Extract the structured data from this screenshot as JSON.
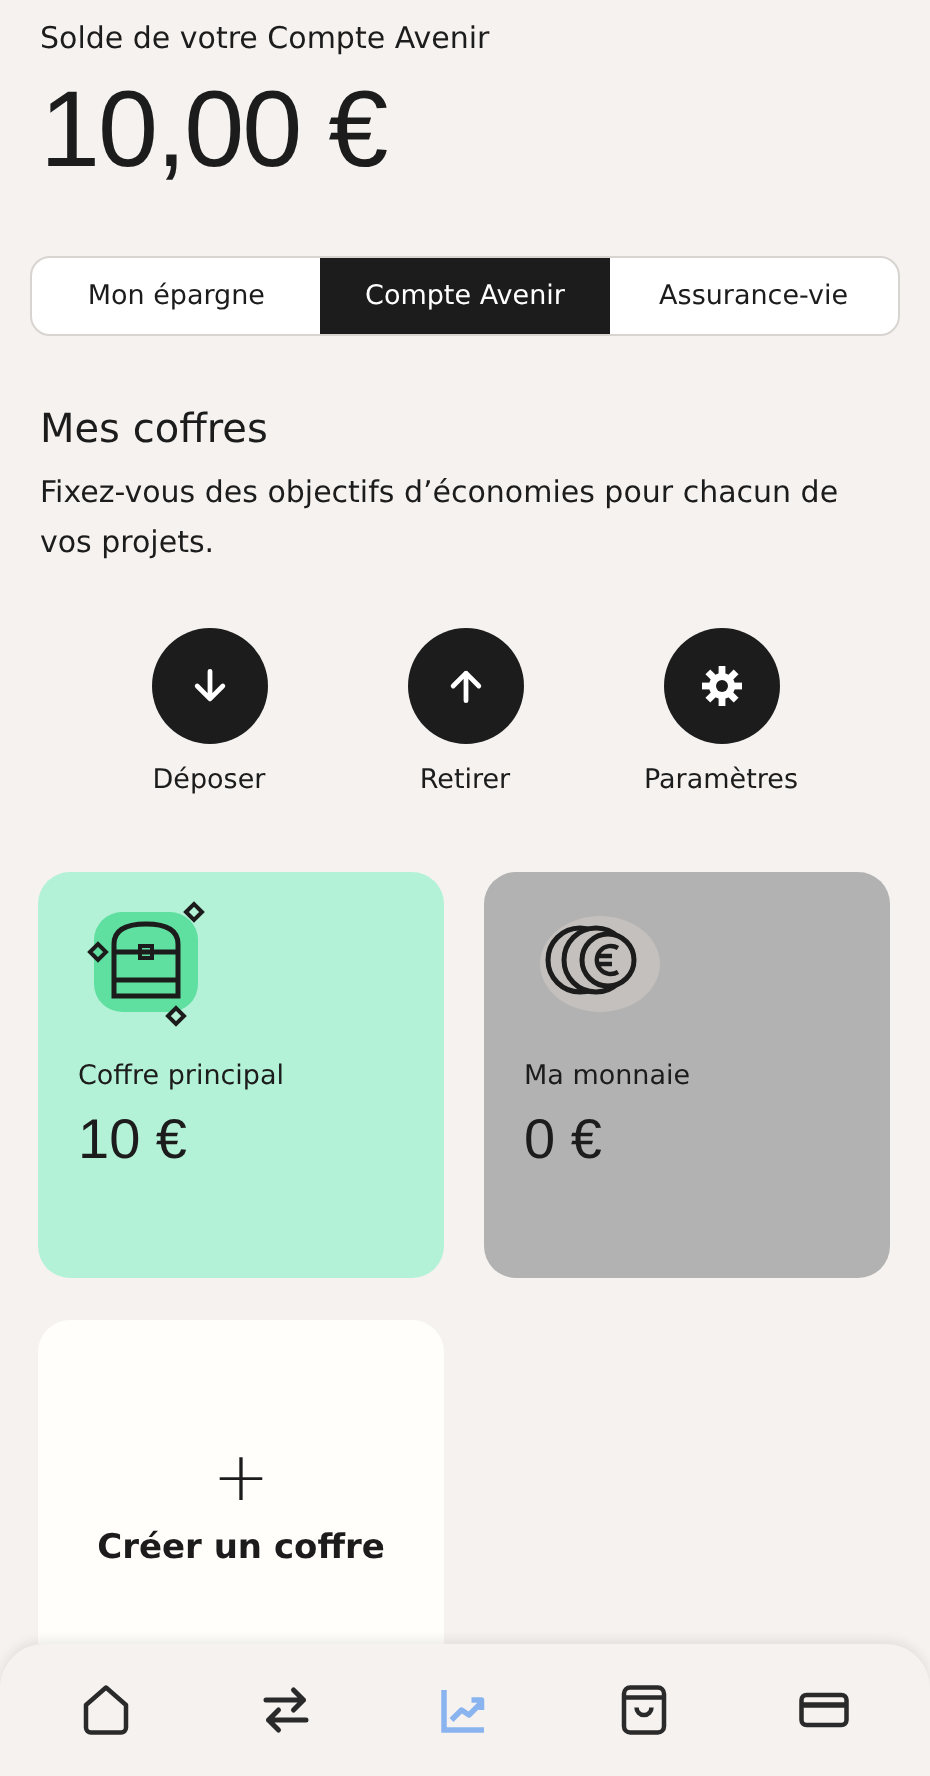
{
  "balance": {
    "label": "Solde de votre Compte Avenir",
    "amount": "10,00 €"
  },
  "tabs": [
    {
      "label": "Mon épargne",
      "selected": false
    },
    {
      "label": "Compte Avenir",
      "selected": true
    },
    {
      "label": "Assurance-vie",
      "selected": false
    }
  ],
  "section": {
    "title": "Mes coffres",
    "description": "Fixez-vous des objectifs d’économies pour chacun de vos projets."
  },
  "actions": [
    {
      "kind": "deposit",
      "label": "Déposer"
    },
    {
      "kind": "withdraw",
      "label": "Retirer"
    },
    {
      "kind": "settings",
      "label": "Paramètres"
    }
  ],
  "vaults": [
    {
      "kind": "chest",
      "name": "Coffre principal",
      "amount": "10 €",
      "color": "#b4f2d8"
    },
    {
      "kind": "coins",
      "name": "Ma monnaie",
      "amount": "0 €",
      "color": "#b2b2b2"
    }
  ],
  "create": {
    "icon": "+",
    "label": "Créer un coffre"
  },
  "nav": [
    {
      "kind": "home",
      "selected": false
    },
    {
      "kind": "transfer",
      "selected": false
    },
    {
      "kind": "invest",
      "selected": true
    },
    {
      "kind": "shop",
      "selected": false
    },
    {
      "kind": "card",
      "selected": false
    }
  ]
}
